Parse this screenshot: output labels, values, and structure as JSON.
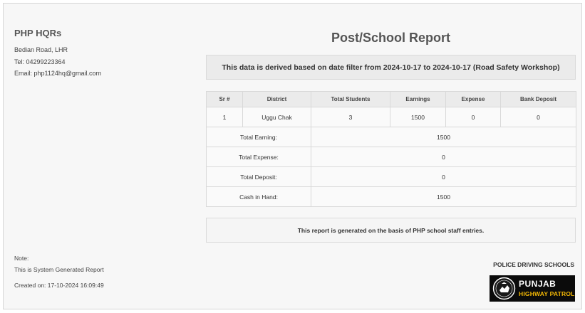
{
  "org": {
    "name": "PHP HQRs",
    "address": "Bedian Road, LHR",
    "tel": "Tel: 04299223364",
    "email": "Email: php1124hq@gmail.com"
  },
  "report": {
    "title": "Post/School Report",
    "filter_text": "This data is derived based on date filter from 2024-10-17 to 2024-10-17 (Road Safety Workshop)"
  },
  "table": {
    "headers": [
      "Sr #",
      "District",
      "Total Students",
      "Earnings",
      "Expense",
      "Bank Deposit"
    ],
    "rows": [
      [
        "1",
        "Uggu Chak",
        "3",
        "1500",
        "0",
        "0"
      ]
    ],
    "summary": [
      {
        "label": "Total Earning:",
        "value": "1500"
      },
      {
        "label": "Total Expense:",
        "value": "0"
      },
      {
        "label": "Total Deposit:",
        "value": "0"
      },
      {
        "label": "Cash in Hand:",
        "value": "1500"
      }
    ]
  },
  "report_note": "This report is generated on the basis of PHP school staff entries.",
  "footer": {
    "note_label": "Note:",
    "note_text": "This is System Generated Report",
    "created_on": "Created on: 17-10-2024 16:09:49",
    "school_label": "POLICE DRIVING SCHOOLS"
  },
  "logo": {
    "line1": "PUNJAB",
    "line2": "HIGHWAY PATROL",
    "icon": "highway-patrol-emblem-icon",
    "colors": {
      "background": "#0b0b0b",
      "accent": "#f2b705",
      "text": "#ffffff"
    }
  }
}
